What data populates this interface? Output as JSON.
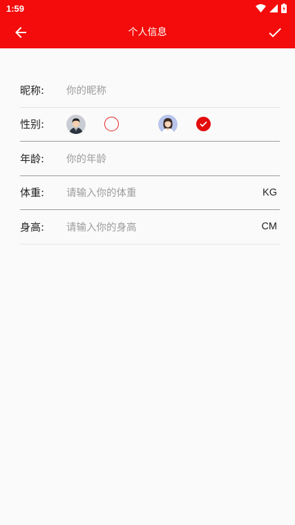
{
  "status_bar": {
    "time": "1:59"
  },
  "toolbar": {
    "title": "个人信息"
  },
  "form": {
    "nickname": {
      "label": "昵称:",
      "placeholder": "你的昵称"
    },
    "gender": {
      "label": "性别:",
      "options": [
        {
          "avatar": "male-avatar-icon",
          "selected": false
        },
        {
          "avatar": "female-avatar-icon",
          "selected": true
        }
      ]
    },
    "age": {
      "label": "年龄:",
      "placeholder": "你的年龄"
    },
    "weight": {
      "label": "体重:",
      "placeholder": "请输入你的体重",
      "unit": "KG"
    },
    "height": {
      "label": "身高:",
      "placeholder": "请输入你的身高",
      "unit": "CM"
    }
  },
  "colors": {
    "accent": "#f40b0b",
    "background": "#fafafa"
  }
}
